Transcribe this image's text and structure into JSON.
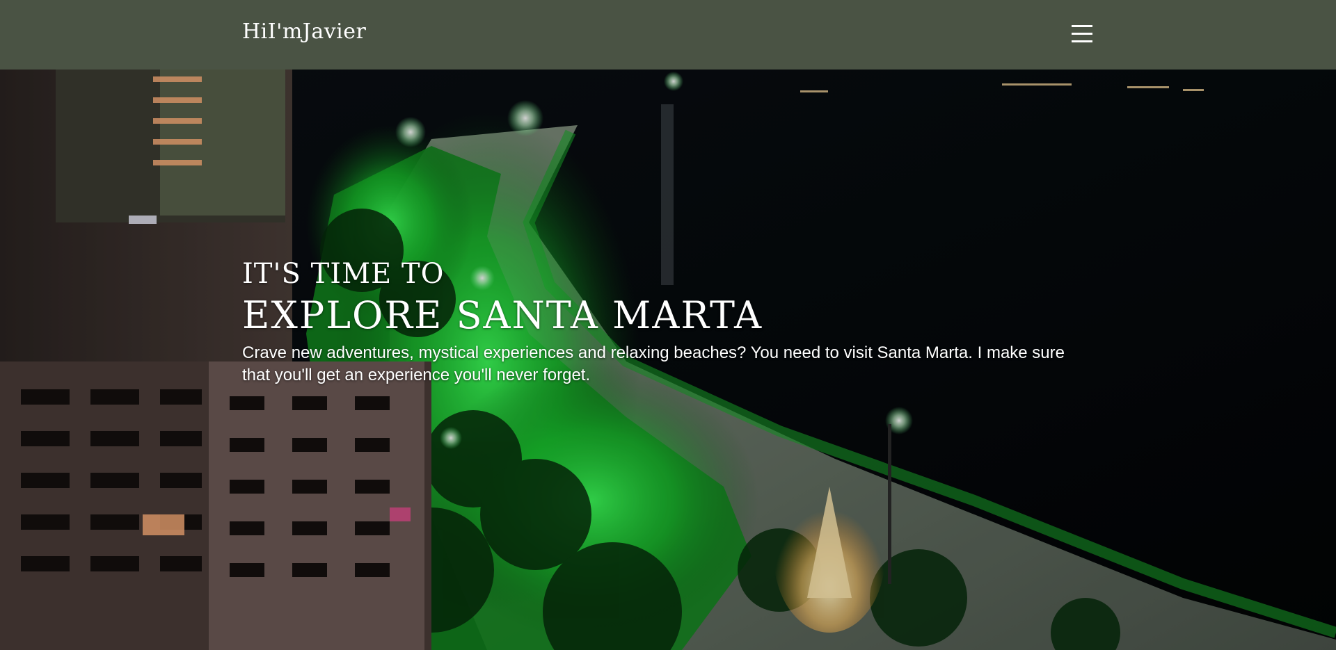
{
  "header": {
    "logo_text": "HiI'mJavier",
    "menu_icon": "hamburger-menu-icon",
    "background_color": "#4a5344"
  },
  "hero": {
    "kicker": "IT'S TIME TO",
    "title": "EXPLORE SANTA MARTA",
    "description": "Crave new adventures, mystical experiences and relaxing beaches? You need to visit Santa Marta. I make sure that you'll get an experience you'll never forget.",
    "background_image": "night-beach-city-photo"
  }
}
